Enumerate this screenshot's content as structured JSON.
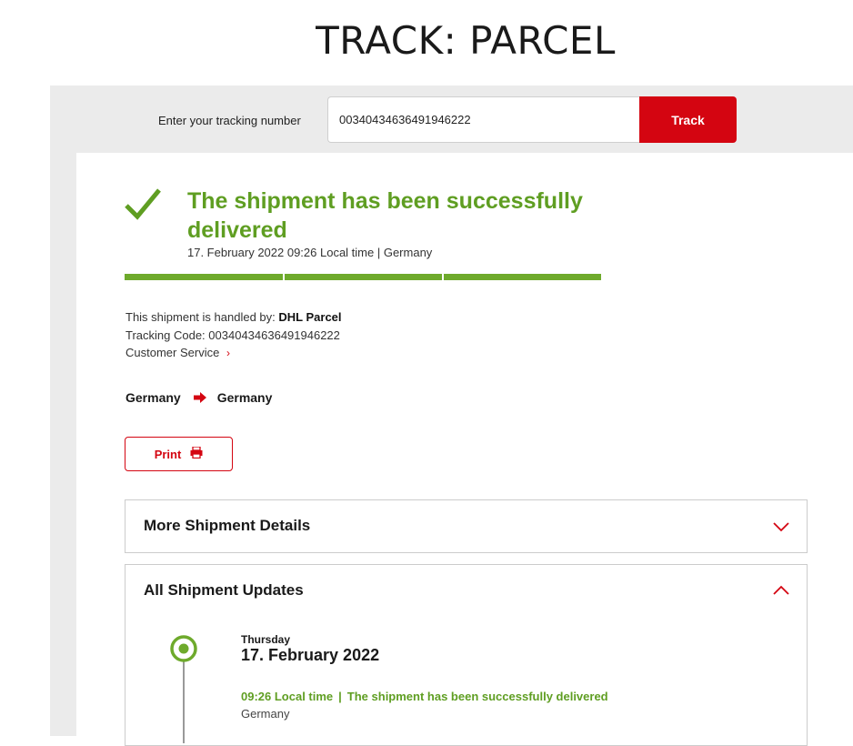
{
  "page_title": "TRACK: PARCEL",
  "search": {
    "label": "Enter your tracking number",
    "value": "00340434636491946222",
    "button_label": "Track"
  },
  "status": {
    "heading": "The shipment has been successfully delivered",
    "meta": "17. February 2022 09:26 Local time | Germany",
    "progress": 1.0
  },
  "info": {
    "handled_by_label": "This shipment is handled by:",
    "handled_by_value": "DHL Parcel",
    "tracking_code_label": "Tracking Code:",
    "tracking_code_value": "00340434636491946222",
    "customer_service": "Customer Service",
    "customer_service_chevron": "›"
  },
  "route": {
    "origin": "Germany",
    "destination": "Germany"
  },
  "print_label": "Print",
  "sections": {
    "details_title": "More Shipment Details",
    "updates_title": "All Shipment Updates"
  },
  "updates": [
    {
      "weekday": "Thursday",
      "date": "17. February 2022",
      "time": "09:26 Local time",
      "separator": "|",
      "description": "The shipment has been successfully delivered",
      "location": "Germany"
    }
  ],
  "colors": {
    "brand_red": "#d40511",
    "success_green": "#5f9e22",
    "panel_grey": "#ebebeb"
  },
  "icons": [
    "check-icon",
    "red-chevron-right-icon",
    "arrow-right-icon",
    "printer-icon",
    "chevron-down-icon",
    "chevron-up-icon",
    "timeline-dot-icon"
  ]
}
